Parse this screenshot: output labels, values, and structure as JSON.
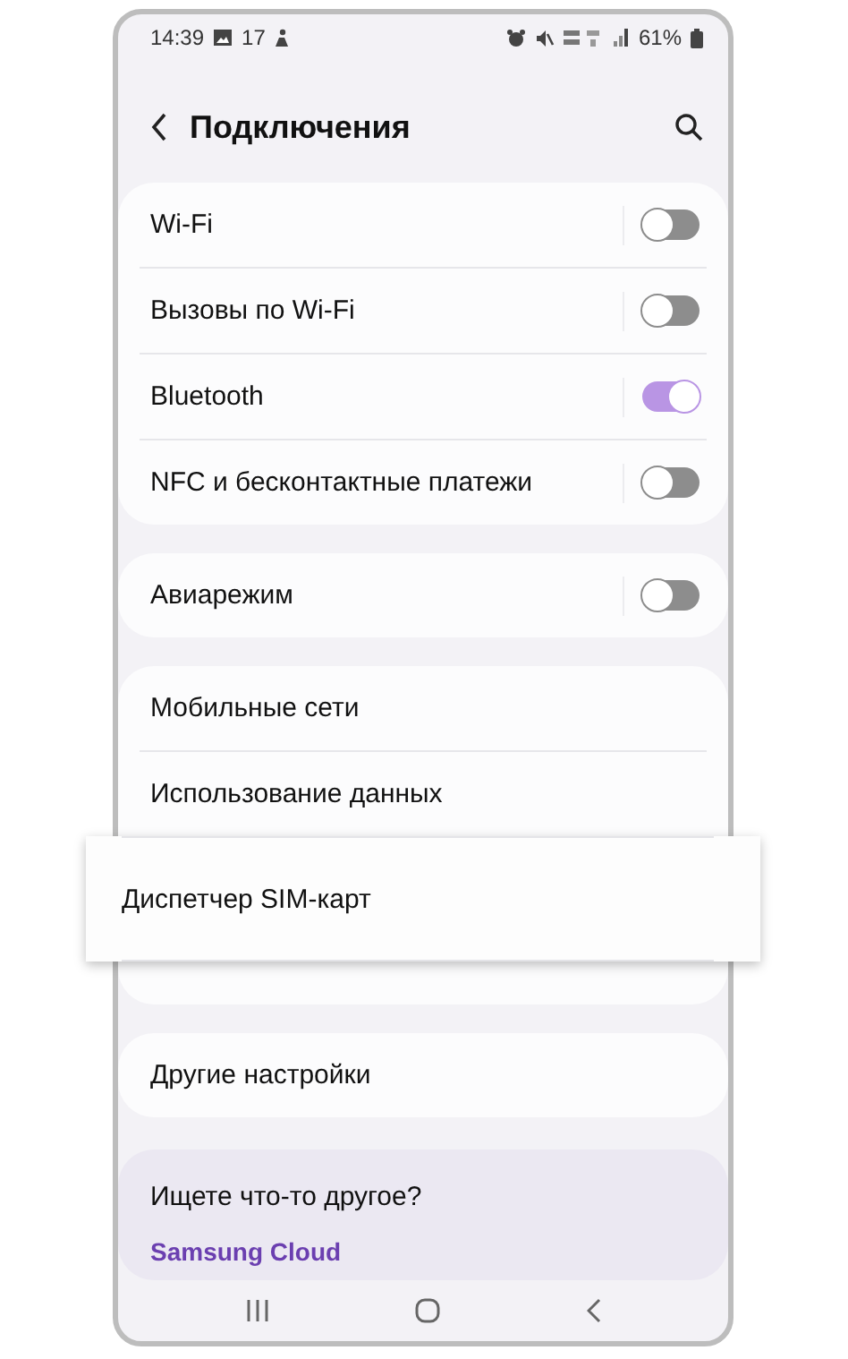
{
  "status_bar": {
    "time": "14:39",
    "notification_count": "17",
    "battery": "61%"
  },
  "header": {
    "title": "Подключения"
  },
  "groups": [
    {
      "items": [
        {
          "label": "Wi-Fi",
          "kind": "toggle",
          "on": false
        },
        {
          "label": "Вызовы по Wi-Fi",
          "kind": "toggle",
          "on": false
        },
        {
          "label": "Bluetooth",
          "kind": "toggle",
          "on": true
        },
        {
          "label": "NFC и бесконтактные платежи",
          "kind": "toggle",
          "on": false
        }
      ]
    },
    {
      "items": [
        {
          "label": "Авиарежим",
          "kind": "toggle",
          "on": false
        }
      ]
    },
    {
      "items": [
        {
          "label": "Мобильные сети",
          "kind": "link"
        },
        {
          "label": "Использование данных",
          "kind": "link"
        },
        {
          "label": "Диспетчер SIM-карт",
          "kind": "raised"
        }
      ]
    },
    {
      "items": [
        {
          "label": "Другие настройки",
          "kind": "link"
        }
      ]
    }
  ],
  "suggestion": {
    "question": "Ищете что-то другое?",
    "link": "Samsung Cloud"
  }
}
